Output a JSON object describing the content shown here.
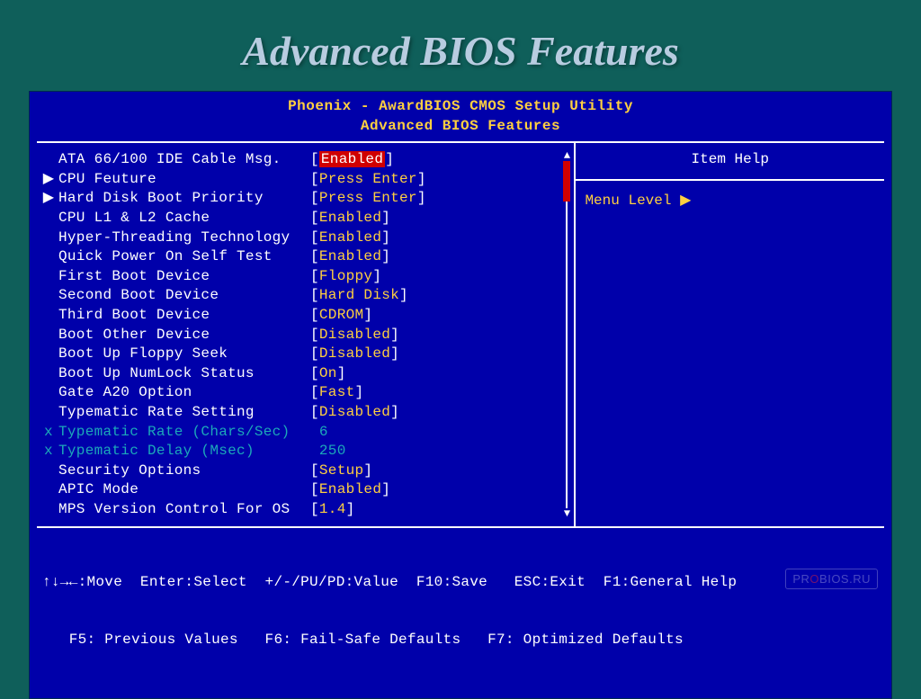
{
  "slide": {
    "title": "Advanced BIOS Features"
  },
  "bios": {
    "header_line1": "Phoenix - AwardBIOS CMOS Setup Utility",
    "header_line2": "Advanced BIOS Features",
    "rows": [
      {
        "marker": " ",
        "label": "ATA 66/100 IDE Cable Msg.",
        "value": "Enabled",
        "selected": true
      },
      {
        "marker": "▶",
        "label": "CPU Feuture",
        "value": "Press Enter"
      },
      {
        "marker": "▶",
        "label": "Hard Disk Boot Priority",
        "value": "Press Enter"
      },
      {
        "marker": " ",
        "label": "CPU L1 & L2 Cache",
        "value": "Enabled"
      },
      {
        "marker": " ",
        "label": "Hyper-Threading Technology",
        "value": "Enabled"
      },
      {
        "marker": " ",
        "label": "Quick Power On Self Test",
        "value": "Enabled"
      },
      {
        "marker": " ",
        "label": "First Boot Device",
        "value": "Floppy"
      },
      {
        "marker": " ",
        "label": "Second Boot Device",
        "value": "Hard Disk"
      },
      {
        "marker": " ",
        "label": "Third Boot Device",
        "value": "CDROM"
      },
      {
        "marker": " ",
        "label": "Boot Other Device",
        "value": "Disabled"
      },
      {
        "marker": " ",
        "label": "Boot Up Floppy Seek",
        "value": "Disabled"
      },
      {
        "marker": " ",
        "label": "Boot Up NumLock Status",
        "value": "On"
      },
      {
        "marker": " ",
        "label": "Gate A20 Option",
        "value": "Fast"
      },
      {
        "marker": " ",
        "label": "Typematic Rate Setting",
        "value": "Disabled"
      },
      {
        "marker": "x",
        "label": "Typematic Rate (Chars/Sec)",
        "value": "6",
        "disabled": true,
        "nobracket": true
      },
      {
        "marker": "x",
        "label": "Typematic Delay (Msec)",
        "value": "250",
        "disabled": true,
        "nobracket": true
      },
      {
        "marker": " ",
        "label": "Security Options",
        "value": "Setup"
      },
      {
        "marker": " ",
        "label": "APIC Mode",
        "value": "Enabled"
      },
      {
        "marker": " ",
        "label": "MPS Version Control For OS",
        "value": "1.4"
      }
    ],
    "help": {
      "title": "Item Help",
      "menu_level": "Menu Level    ▶"
    },
    "footer": {
      "line1": "↑↓→←:Move  Enter:Select  +/-/PU/PD:Value  F10:Save   ESC:Exit  F1:General Help",
      "line2": "   F5: Previous Values   F6: Fail-Safe Defaults   F7: Optimized Defaults"
    }
  },
  "watermark": {
    "text_pre": "PR",
    "text_accent": "O",
    "text_post": "BIOS.RU"
  }
}
